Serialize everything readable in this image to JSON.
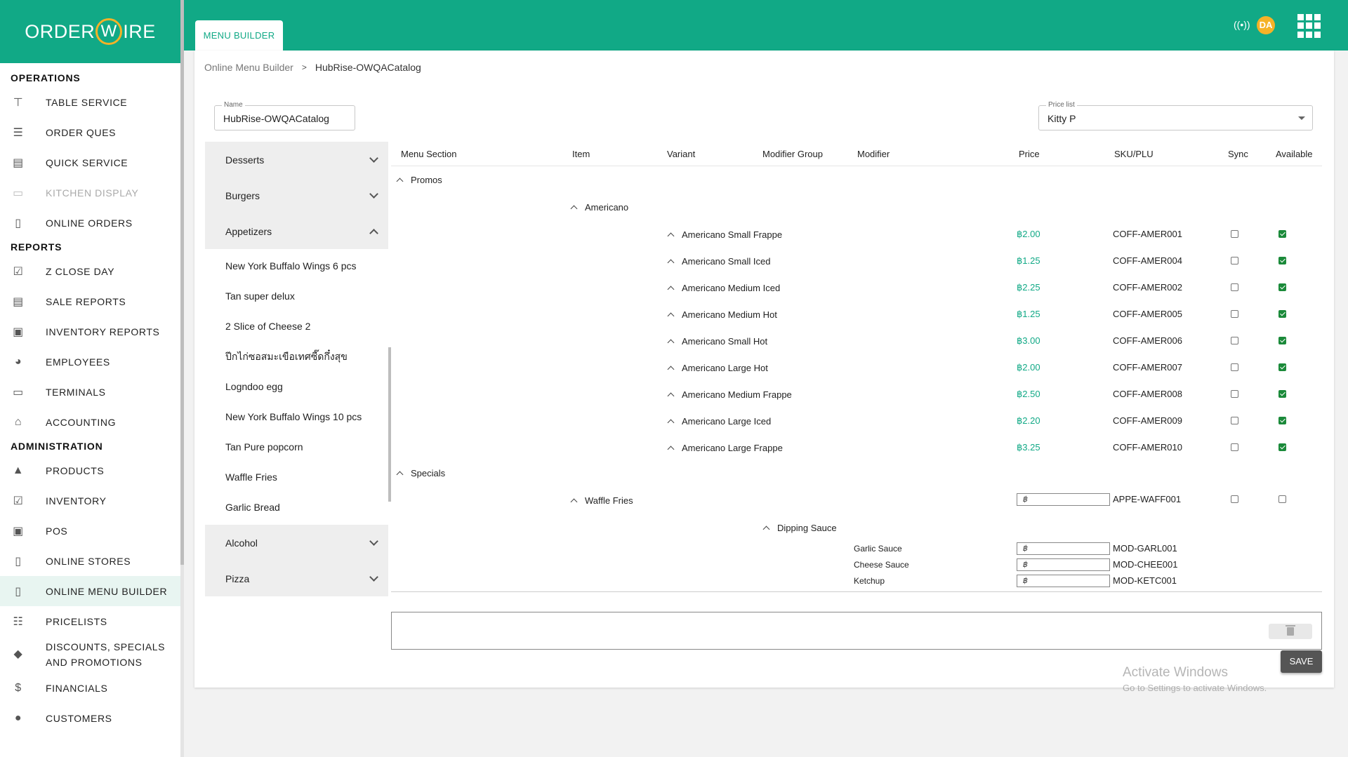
{
  "brand": {
    "logo_left": "ORDER",
    "logo_mid": "W",
    "logo_right": "IRE"
  },
  "sidebar": {
    "sections": [
      {
        "title": "OPERATIONS",
        "items": [
          {
            "label": "TABLE SERVICE",
            "icon": "table-icon"
          },
          {
            "label": "ORDER QUES",
            "icon": "list-icon"
          },
          {
            "label": "QUICK SERVICE",
            "icon": "register-icon"
          },
          {
            "label": "KITCHEN DISPLAY",
            "icon": "monitor-icon",
            "disabled": true
          },
          {
            "label": "ONLINE ORDERS",
            "icon": "tablet-icon"
          }
        ]
      },
      {
        "title": "REPORTS",
        "items": [
          {
            "label": "Z CLOSE DAY",
            "icon": "calendar-icon"
          },
          {
            "label": "SALE REPORTS",
            "icon": "document-icon"
          },
          {
            "label": "INVENTORY REPORTS",
            "icon": "inventory-icon"
          },
          {
            "label": "EMPLOYEES",
            "icon": "employees-icon"
          },
          {
            "label": "TERMINALS",
            "icon": "terminals-icon"
          },
          {
            "label": "ACCOUNTING",
            "icon": "bank-icon"
          }
        ]
      },
      {
        "title": "ADMINISTRATION",
        "items": [
          {
            "label": "PRODUCTS",
            "icon": "shapes-icon"
          },
          {
            "label": "INVENTORY",
            "icon": "checklist-icon"
          },
          {
            "label": "POS",
            "icon": "pos-icon"
          },
          {
            "label": "ONLINE STORES",
            "icon": "store-icon"
          },
          {
            "label": "ONLINE MENU BUILDER",
            "icon": "menu-builder-icon",
            "active": true
          },
          {
            "label": "PRICELISTS",
            "icon": "pricelist-icon"
          },
          {
            "label": "DISCOUNTS, SPECIALS AND PROMOTIONS",
            "icon": "tag-icon"
          },
          {
            "label": "FINANCIALS",
            "icon": "dollar-icon"
          },
          {
            "label": "CUSTOMERS",
            "icon": "user-icon"
          }
        ]
      }
    ]
  },
  "topbar": {
    "tab": "MENU BUILDER",
    "avatar": "DA"
  },
  "breadcrumb": {
    "root": "Online Menu Builder",
    "current": "HubRise-OWQACatalog"
  },
  "form": {
    "name_label": "Name",
    "name_value": "HubRise-OWQACatalog",
    "pricelist_label": "Price list",
    "pricelist_value": "Kitty P"
  },
  "categories": {
    "top": [
      {
        "label": "Desserts"
      },
      {
        "label": "Burgers"
      }
    ],
    "expanded": {
      "label": "Appetizers",
      "items": [
        "New York Buffalo Wings 6 pcs",
        "Tan super delux",
        "2 Slice of Cheese 2",
        "ปีกไก่ซอสมะเขือเทศซี๊ดกึ๋งสุข",
        "Logndoo egg",
        "New York Buffalo Wings 10 pcs",
        "Tan Pure popcorn",
        "Waffle Fries",
        "Garlic Bread"
      ]
    },
    "bottom": [
      {
        "label": "Alcohol"
      },
      {
        "label": "Pizza"
      }
    ]
  },
  "grid": {
    "headers": {
      "section": "Menu Section",
      "item": "Item",
      "variant": "Variant",
      "modifier_group": "Modifier Group",
      "modifier": "Modifier",
      "price": "Price",
      "sku": "SKU/PLU",
      "sync": "Sync",
      "available": "Available"
    },
    "promos": {
      "section": "Promos",
      "item": "Americano",
      "variants": [
        {
          "name": "Americano Small Frappe",
          "price": "฿2.00",
          "sku": "COFF-AMER001",
          "sync": false,
          "available": true
        },
        {
          "name": "Americano Small Iced",
          "price": "฿1.25",
          "sku": "COFF-AMER004",
          "sync": false,
          "available": true
        },
        {
          "name": "Americano Medium Iced",
          "price": "฿2.25",
          "sku": "COFF-AMER002",
          "sync": false,
          "available": true
        },
        {
          "name": "Americano Medium Hot",
          "price": "฿1.25",
          "sku": "COFF-AMER005",
          "sync": false,
          "available": true
        },
        {
          "name": "Americano Small Hot",
          "price": "฿3.00",
          "sku": "COFF-AMER006",
          "sync": false,
          "available": true
        },
        {
          "name": "Americano Large Hot",
          "price": "฿2.00",
          "sku": "COFF-AMER007",
          "sync": false,
          "available": true
        },
        {
          "name": "Americano Medium Frappe",
          "price": "฿2.50",
          "sku": "COFF-AMER008",
          "sync": false,
          "available": true
        },
        {
          "name": "Americano Large Iced",
          "price": "฿2.20",
          "sku": "COFF-AMER009",
          "sync": false,
          "available": true
        },
        {
          "name": "Americano Large Frappe",
          "price": "฿3.25",
          "sku": "COFF-AMER010",
          "sync": false,
          "available": true
        }
      ]
    },
    "specials": {
      "section": "Specials",
      "item": "Waffle Fries",
      "item_price": "฿",
      "item_sku": "APPE-WAFF001",
      "modifier_group": "Dipping Sauce",
      "modifiers": [
        {
          "name": "Garlic Sauce",
          "price": "฿",
          "sku": "MOD-GARL001"
        },
        {
          "name": "Cheese Sauce",
          "price": "฿",
          "sku": "MOD-CHEE001"
        },
        {
          "name": "Ketchup",
          "price": "฿",
          "sku": "MOD-KETC001"
        }
      ]
    }
  },
  "actions": {
    "save": "SAVE"
  },
  "watermark": {
    "line1": "Activate Windows",
    "line2": "Go to Settings to activate Windows."
  }
}
